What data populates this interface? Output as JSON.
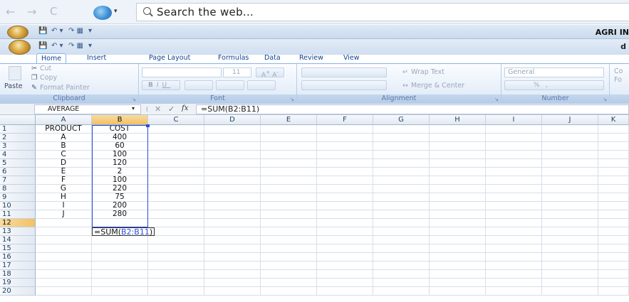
{
  "browser": {
    "search_placeholder": "Search the web...",
    "back_icon": "←",
    "forward_icon": "→",
    "reload_icon": "C",
    "logo_caret": "▾"
  },
  "outer_window": {
    "title": "AGRI IN",
    "qat_icons": [
      "save-icon",
      "undo-icon",
      "redo-icon"
    ]
  },
  "inner_window": {
    "title_fragment": "d"
  },
  "ribbon": {
    "tabs": [
      "Home",
      "Insert",
      "Page Layout",
      "Formulas",
      "Data",
      "Review",
      "View"
    ],
    "active_tab": "Home",
    "clipboard": {
      "label": "Clipboard",
      "paste": "Paste",
      "cut": "Cut",
      "copy": "Copy",
      "format_painter": "Format Painter"
    },
    "font": {
      "label": "Font",
      "size": "11",
      "grow": "A",
      "shrink": "A",
      "bold": "B",
      "italic": "I",
      "underline": "U"
    },
    "alignment": {
      "label": "Alignment",
      "wrap_text": "Wrap Text",
      "merge_center": "Merge & Center"
    },
    "number": {
      "label": "Number",
      "format": "General",
      "percent": "%",
      "comma": ","
    },
    "styles_fragment": {
      "line1": "Co",
      "line2": "Fo"
    }
  },
  "formula_bar": {
    "name_box": "AVERAGE",
    "name_caret": "▾",
    "cancel": "✕",
    "enter": "✓",
    "fx": "fx",
    "formula": "=SUM(B2:B11)"
  },
  "sheet": {
    "columns": [
      "A",
      "B",
      "C",
      "D",
      "E",
      "F",
      "G",
      "H",
      "I",
      "J",
      "K"
    ],
    "rows": [
      "1",
      "2",
      "3",
      "4",
      "5",
      "6",
      "7",
      "8",
      "9",
      "10",
      "11",
      "12",
      "13",
      "14",
      "15",
      "16",
      "17",
      "18",
      "19",
      "20"
    ],
    "headers": [
      "PRODUCT",
      "COST"
    ],
    "data": [
      [
        "A",
        "400"
      ],
      [
        "B",
        "60"
      ],
      [
        "C",
        "100"
      ],
      [
        "D",
        "120"
      ],
      [
        "E",
        "2"
      ],
      [
        "F",
        "100"
      ],
      [
        "G",
        "220"
      ],
      [
        "H",
        "75"
      ],
      [
        "I",
        "200"
      ],
      [
        "J",
        "280"
      ]
    ],
    "editing_cell": {
      "prefix": "=SUM(",
      "ref": "B2:B11",
      "suffix": ")"
    }
  },
  "colors": {
    "selection_border": "#2a4dd8",
    "header_highlight": "#f3c161",
    "ribbon_blue": "#15428b"
  }
}
